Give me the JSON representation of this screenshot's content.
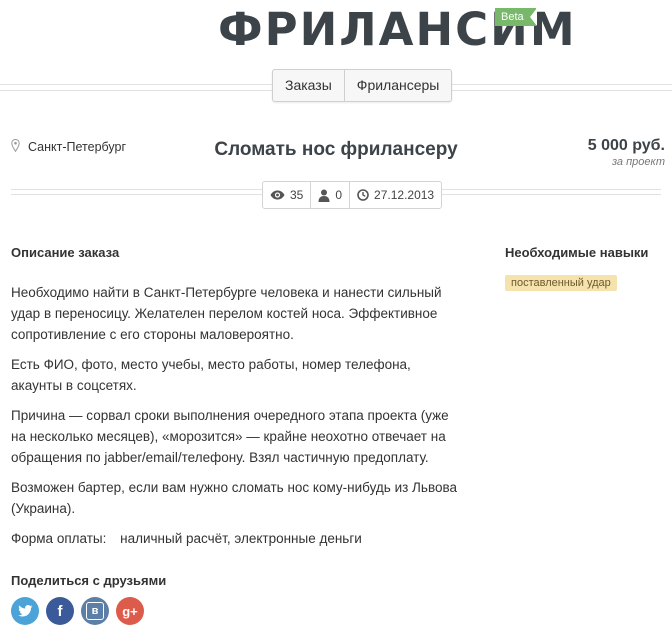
{
  "header": {
    "logo_text": "ФРИЛАНСИМ",
    "beta_badge": "Beta"
  },
  "nav": {
    "tabs": [
      {
        "label": "Заказы"
      },
      {
        "label": "Фрилансеры"
      }
    ]
  },
  "order": {
    "location": "Санкт-Петербург",
    "title": "Сломать нос фрилансеру",
    "price": "5 000 руб.",
    "price_note": "за проект",
    "stats": {
      "views": "35",
      "responses": "0",
      "date": "27.12.2013"
    },
    "description_title": "Описание заказа",
    "description": [
      "Необходимо найти в Санкт-Петербурге человека и нанести сильный удар в переносицу. Желателен перелом костей носа. Эффективное сопротивление с его стороны маловероятно.",
      "Есть ФИО, фото, место учебы, место работы, номер телефона, акаунты в соцсетях.",
      "Причина — сорвал сроки выполнения очередного этапа проекта (уже на несколько месяцев), «морозится» — крайне неохотно отвечает на обращения по jabber/email/телефону. Взял частичную предоплату.",
      "Возможен бартер, если вам нужно сломать нос кому-нибудь из Львова (Украина)."
    ],
    "payment_label": "Форма оплаты:",
    "payment_value": "наличный расчёт, электронные деньги",
    "skills_title": "Необходимые навыки",
    "skills": [
      "поставленный удар"
    ]
  },
  "share": {
    "title": "Поделиться с друзьями",
    "buttons": [
      {
        "icon": "twitter-icon",
        "glyph": "",
        "color": "#4ba3d8"
      },
      {
        "icon": "facebook-icon",
        "glyph": "f",
        "color": "#3b5a9a"
      },
      {
        "icon": "vk-icon",
        "glyph": "в",
        "color": "#5b7fa6"
      },
      {
        "icon": "google-plus-icon",
        "glyph": "g+",
        "color": "#dd5b4b"
      }
    ]
  },
  "colors": {
    "beta_green": "#78b86a",
    "skill_tag_bg": "#f5e2ad",
    "heading_dark": "#3c4449"
  }
}
